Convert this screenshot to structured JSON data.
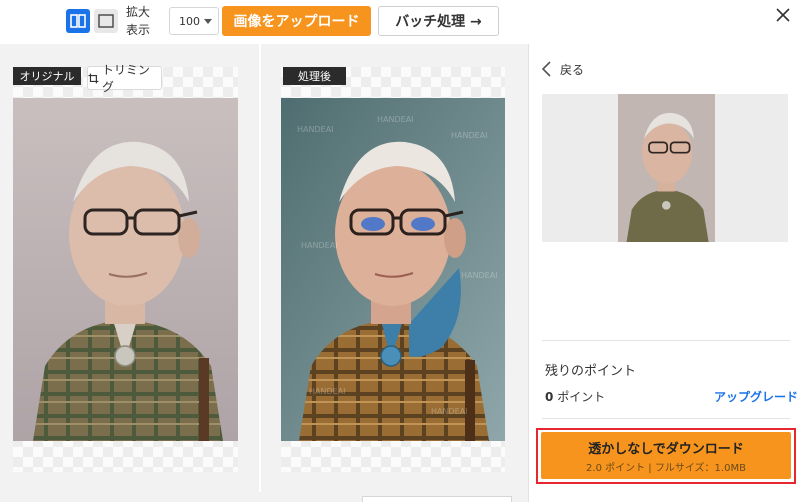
{
  "toolbar": {
    "zoom_label_line1": "拡大",
    "zoom_label_line2": "表示",
    "zoom_value": "100",
    "upload_label": "画像をアップロード",
    "batch_label": "バッチ処理 →"
  },
  "workspace": {
    "original_tag": "オリジナル",
    "trim_label": "トリミング",
    "processed_tag": "処理後",
    "watermark_text": "HANDEAI"
  },
  "panel": {
    "back_label": "戻る",
    "points_title": "残りのポイント",
    "points_count": "0",
    "points_unit": "ポイント",
    "upgrade_label": "アップグレード",
    "download_label": "透かしなしでダウンロード",
    "download_sub": "2.0 ポイント | フルサイズ：1.0MB"
  },
  "colors": {
    "accent_orange": "#f7941d",
    "accent_blue": "#1a73e8",
    "highlight_red": "#e8262d"
  },
  "icons": [
    "split-view-icon",
    "single-view-icon",
    "chevron-down-icon",
    "close-icon",
    "crop-icon",
    "chevron-left-icon"
  ]
}
